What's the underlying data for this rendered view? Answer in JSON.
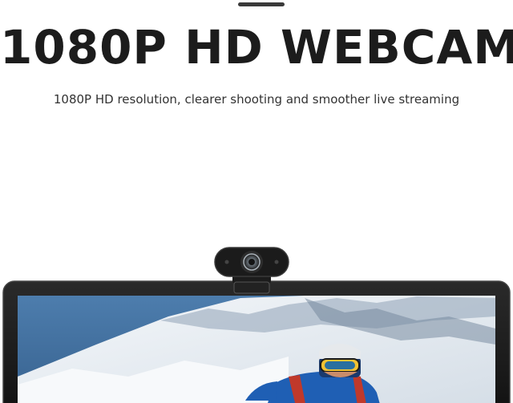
{
  "headline": {
    "title": "1080P HD WEBCAM",
    "subtitle": "1080P HD resolution, clearer shooting and smoother live streaming"
  },
  "colors": {
    "title": "#1c1c1c",
    "subtitle": "#333333",
    "monitor_bezel": "#1a1a1a",
    "sky": "#3f6f9f",
    "snow": "#e9eef3",
    "jacket": "#1f5fb4"
  },
  "icons": {
    "webcam": "webcam-icon",
    "monitor": "monitor-icon"
  }
}
